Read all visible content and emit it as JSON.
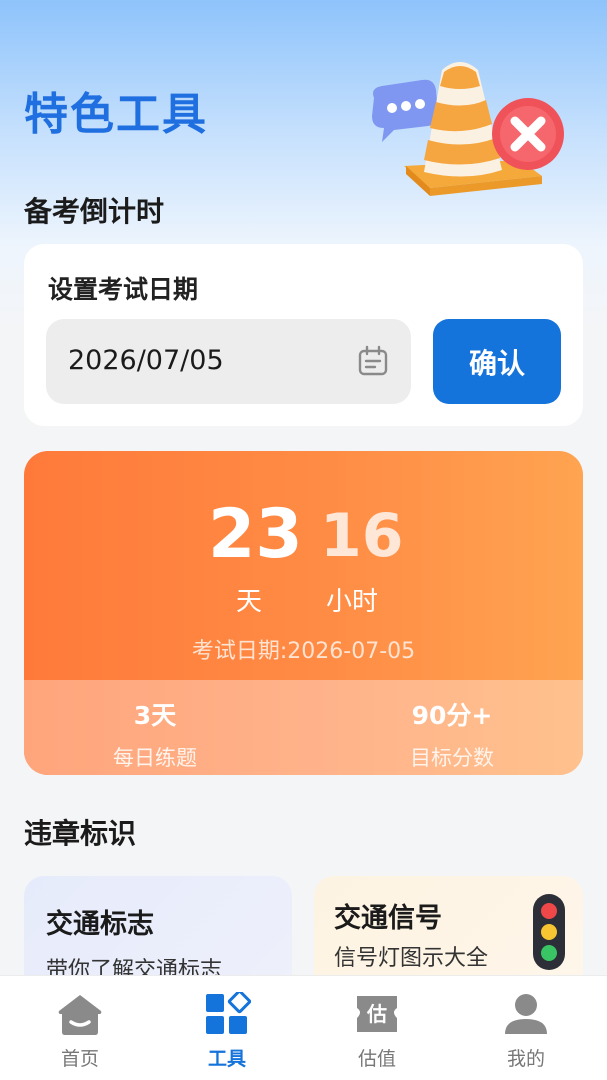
{
  "header": {
    "title": "特色工具"
  },
  "countdown_section": {
    "title": "备考倒计时"
  },
  "date_setting": {
    "label": "设置考试日期",
    "date_value": "2026/07/05",
    "confirm_label": "确认"
  },
  "countdown": {
    "days": "23",
    "hours": "16",
    "days_unit": "天",
    "hours_unit": "小时",
    "exam_date_text": "考试日期:2026-07-05",
    "stats": [
      {
        "value": "3天",
        "label": "每日练题"
      },
      {
        "value": "90分+",
        "label": "目标分数"
      }
    ]
  },
  "violation_section": {
    "title": "违章标识"
  },
  "cards": [
    {
      "title": "交通标志",
      "subtitle": "带你了解交通标志",
      "icon": "none"
    },
    {
      "title": "交通信号",
      "subtitle": "信号灯图示大全",
      "icon": "traffic-light-icon"
    }
  ],
  "tabbar": {
    "items": [
      {
        "label": "首页",
        "icon": "home-icon",
        "active": false
      },
      {
        "label": "工具",
        "icon": "tools-icon",
        "active": true
      },
      {
        "label": "估值",
        "icon": "valuation-icon",
        "active": false,
        "icon_text": "估"
      },
      {
        "label": "我的",
        "icon": "profile-icon",
        "active": false
      }
    ]
  },
  "colors": {
    "accent": "#1573dc",
    "title_blue": "#1f6fe0",
    "countdown_orange": "#ff7a3a"
  }
}
